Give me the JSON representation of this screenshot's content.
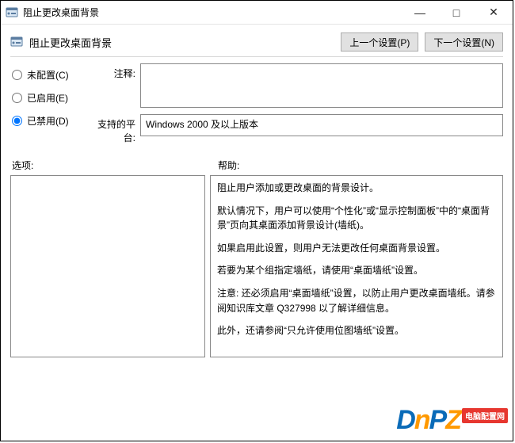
{
  "window": {
    "title": "阻止更改桌面背景"
  },
  "header": {
    "title": "阻止更改桌面背景",
    "prev": "上一个设置(P)",
    "next": "下一个设置(N)"
  },
  "radio": {
    "not_configured": "未配置(C)",
    "enabled": "已启用(E)",
    "disabled": "已禁用(D)"
  },
  "fields": {
    "comment_label": "注释:",
    "comment_value": "",
    "platform_label": "支持的平台:",
    "platform_value": "Windows 2000 及以上版本"
  },
  "labels": {
    "options": "选项:",
    "help": "帮助:"
  },
  "help": {
    "p1": "阻止用户添加或更改桌面的背景设计。",
    "p2": "默认情况下，用户可以使用“个性化”或“显示控制面板”中的“桌面背景”页向其桌面添加背景设计(墙纸)。",
    "p3": "如果启用此设置，则用户无法更改任何桌面背景设置。",
    "p4": "若要为某个组指定墙纸，请使用“桌面墙纸”设置。",
    "p5": "注意: 还必须启用“桌面墙纸”设置，以防止用户更改桌面墙纸。请参阅知识库文章 Q327998 以了解详细信息。",
    "p6": "此外，还请参阅“只允许使用位图墙纸”设置。"
  },
  "watermark": {
    "d": "D",
    "n": "n",
    "p": "P",
    "z": "Z",
    "badge": "电脑配置网"
  }
}
